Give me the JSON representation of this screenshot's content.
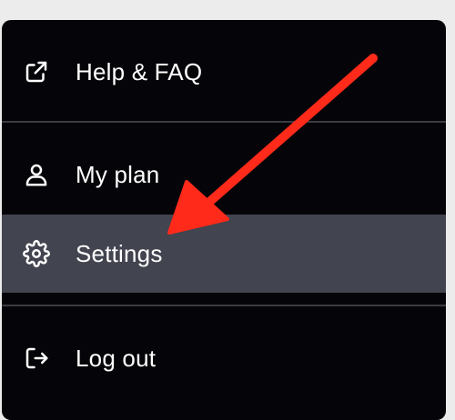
{
  "menu": {
    "items": [
      {
        "label": "Help & FAQ",
        "icon": "external-link-icon"
      },
      {
        "label": "My plan",
        "icon": "user-icon"
      },
      {
        "label": "Settings",
        "icon": "gear-icon",
        "highlighted": true
      },
      {
        "label": "Log out",
        "icon": "logout-icon"
      }
    ]
  },
  "colors": {
    "menu_background": "#050509",
    "highlight": "#42444f",
    "text": "#ffffff",
    "annotation_arrow": "#ff2a1a"
  }
}
